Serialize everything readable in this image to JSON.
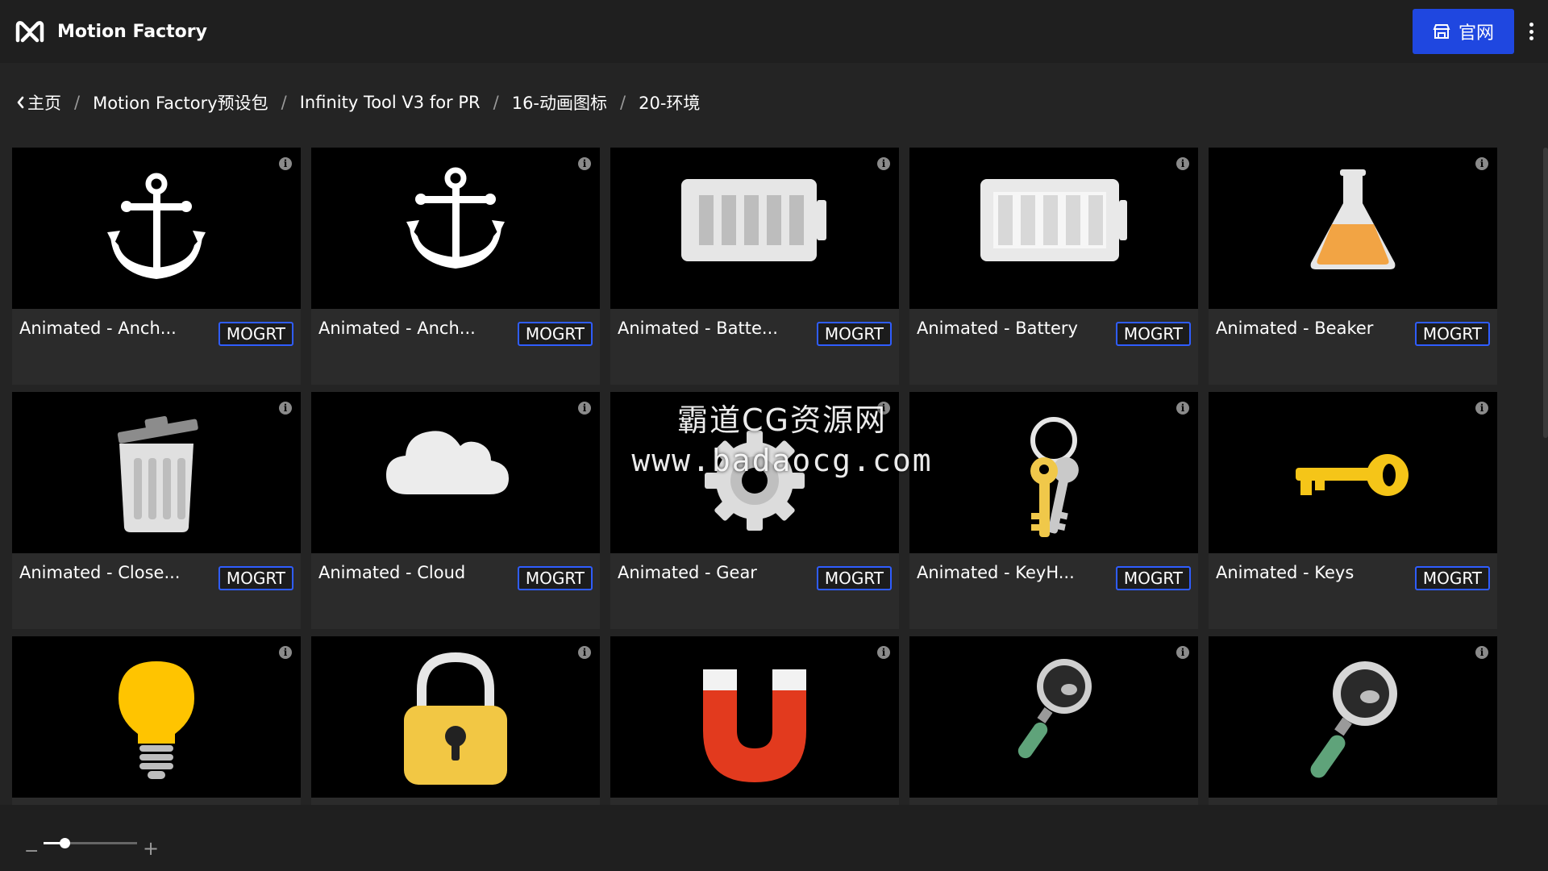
{
  "app": {
    "title": "Motion Factory",
    "site_button_label": "官网"
  },
  "breadcrumb": {
    "home": "主页",
    "items": [
      "Motion Factory预设包",
      "Infinity Tool V3 for PR",
      "16-动画图标",
      "20-环境"
    ]
  },
  "badge_label": "MOGRT",
  "cards": [
    {
      "title": "Animated - Anch...",
      "icon": "anchor-icon"
    },
    {
      "title": "Animated - Anch...",
      "icon": "anchor-icon"
    },
    {
      "title": "Animated - Batte...",
      "icon": "battery-icon"
    },
    {
      "title": "Animated - Battery",
      "icon": "battery-icon"
    },
    {
      "title": "Animated - Beaker",
      "icon": "beaker-icon"
    },
    {
      "title": "Animated - Close...",
      "icon": "trash-can-icon"
    },
    {
      "title": "Animated - Cloud",
      "icon": "cloud-icon"
    },
    {
      "title": "Animated - Gear",
      "icon": "gear-icon"
    },
    {
      "title": "Animated - KeyH...",
      "icon": "key-ring-icon"
    },
    {
      "title": "Animated - Keys",
      "icon": "key-icon"
    },
    {
      "title": "",
      "icon": "lightbulb-icon"
    },
    {
      "title": "",
      "icon": "padlock-icon"
    },
    {
      "title": "",
      "icon": "magnet-icon"
    },
    {
      "title": "",
      "icon": "magnifier-icon"
    },
    {
      "title": "",
      "icon": "magnifier-icon"
    }
  ],
  "watermark": {
    "line1": "霸道CG资源网",
    "line2": "www.badaocg.com"
  },
  "zoom": {
    "minus": "−",
    "plus": "+",
    "level": 0.2
  },
  "colors": {
    "accent": "#1f47e0",
    "badge_border": "#2f5dff",
    "header": "#1f1f1f",
    "background": "#242424"
  }
}
